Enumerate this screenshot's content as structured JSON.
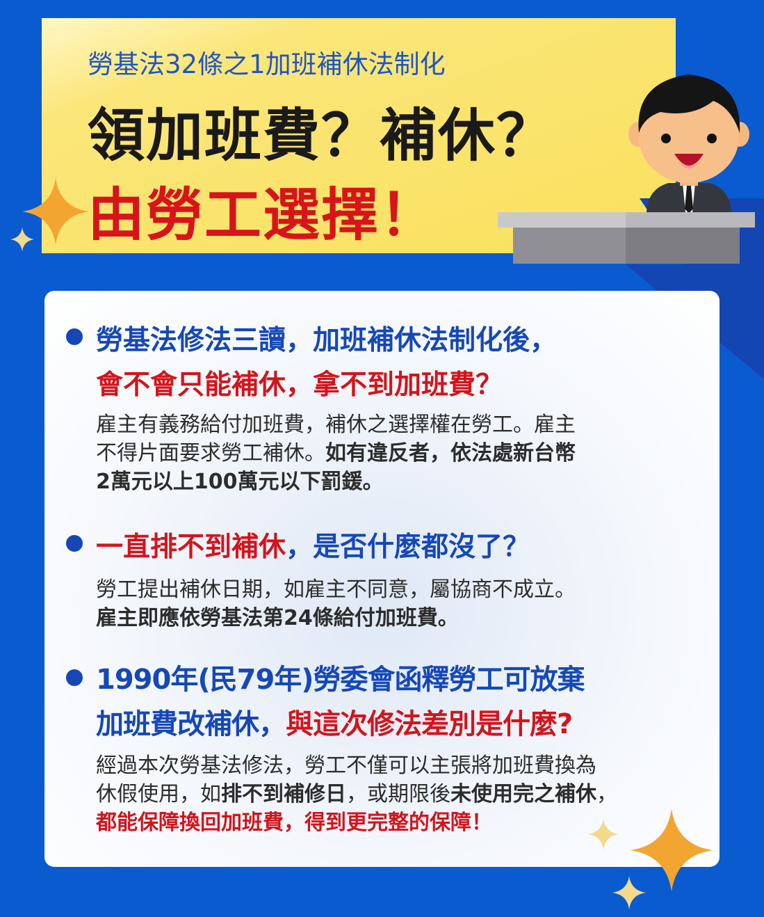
{
  "header": {
    "subtitle": "勞基法32條之1加班補休法制化",
    "title_line1": "領加班費？補休？",
    "title_line2": "由勞工選擇！"
  },
  "sections": [
    {
      "question_blue": "勞基法修法三讀，加班補休法制化後，",
      "question_red": "會不會只能補休，拿不到加班費？",
      "answer_line1": "雇主有義務給付加班費，補休之選擇權在勞工。雇主",
      "answer_line2_normal": "不得片面要求勞工補休。",
      "answer_line2_bold": "如有違反者，依法處新台幣",
      "answer_line3_bold": "2萬元以上100萬元以下罰鍰。"
    },
    {
      "question_red": "一直排不到補休",
      "question_blue": "，是否什麼都沒了？",
      "answer_line1": "勞工提出補休日期，如雇主不同意，屬協商不成立。",
      "answer_line2_bold": "雇主即應依勞基法第24條給付加班費。"
    },
    {
      "question_line1": "1990年(民79年)勞委會函釋勞工可放棄",
      "question_line2_blue": "加班費改補休，",
      "question_line2_red": "與這次修法差別是什麼?",
      "answer_line1": "經過本次勞基法修法，勞工不僅可以主張將加班費換為",
      "answer_line2_a": "休假使用，如",
      "answer_line2_b": "排不到補修日",
      "answer_line2_c": "，或期限後",
      "answer_line2_d": "未使用完之補休",
      "answer_line2_e": "，",
      "answer_line3_red": "都能保障換回加班費，得到更完整的保障！"
    }
  ],
  "colors": {
    "background": "#0a5bd0",
    "header_yellow": "#f9e15d",
    "accent_blue": "#1548b8",
    "accent_red": "#d3141b"
  },
  "icons": [
    "businessman-at-desk-illustration",
    "sparkle-star-icon"
  ]
}
